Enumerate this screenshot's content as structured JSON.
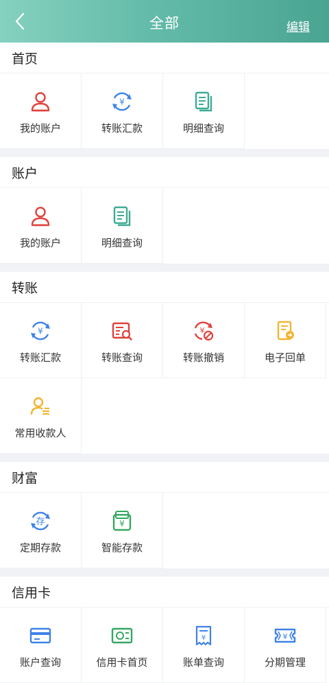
{
  "header": {
    "title": "全部",
    "edit_label": "编辑"
  },
  "sections": [
    {
      "title": "首页",
      "items": [
        {
          "label": "我的账户",
          "icon": "user-icon"
        },
        {
          "label": "转账汇款",
          "icon": "transfer-icon"
        },
        {
          "label": "明细查询",
          "icon": "document-icon"
        }
      ]
    },
    {
      "title": "账户",
      "items": [
        {
          "label": "我的账户",
          "icon": "user-icon"
        },
        {
          "label": "明细查询",
          "icon": "document-icon"
        }
      ]
    },
    {
      "title": "转账",
      "items": [
        {
          "label": "转账汇款",
          "icon": "transfer-icon"
        },
        {
          "label": "转账查询",
          "icon": "transfer-query-icon"
        },
        {
          "label": "转账撤销",
          "icon": "transfer-cancel-icon"
        },
        {
          "label": "电子回单",
          "icon": "receipt-icon"
        },
        {
          "label": "常用收款人",
          "icon": "payee-icon"
        }
      ]
    },
    {
      "title": "财富",
      "items": [
        {
          "label": "定期存款",
          "icon": "fixed-deposit-icon"
        },
        {
          "label": "智能存款",
          "icon": "smart-deposit-icon"
        }
      ]
    },
    {
      "title": "信用卡",
      "items": [
        {
          "label": "账户查询",
          "icon": "card-icon"
        },
        {
          "label": "信用卡首页",
          "icon": "credit-home-icon"
        },
        {
          "label": "账单查询",
          "icon": "bill-icon"
        },
        {
          "label": "分期管理",
          "icon": "installment-icon"
        }
      ]
    }
  ],
  "colors": {
    "header_gradient": [
      "#86d1c0",
      "#4aa492"
    ],
    "red": "#e0413c",
    "blue": "#3e82e8",
    "teal": "#3eab95",
    "yellow": "#f2b532",
    "green": "#33a860"
  }
}
